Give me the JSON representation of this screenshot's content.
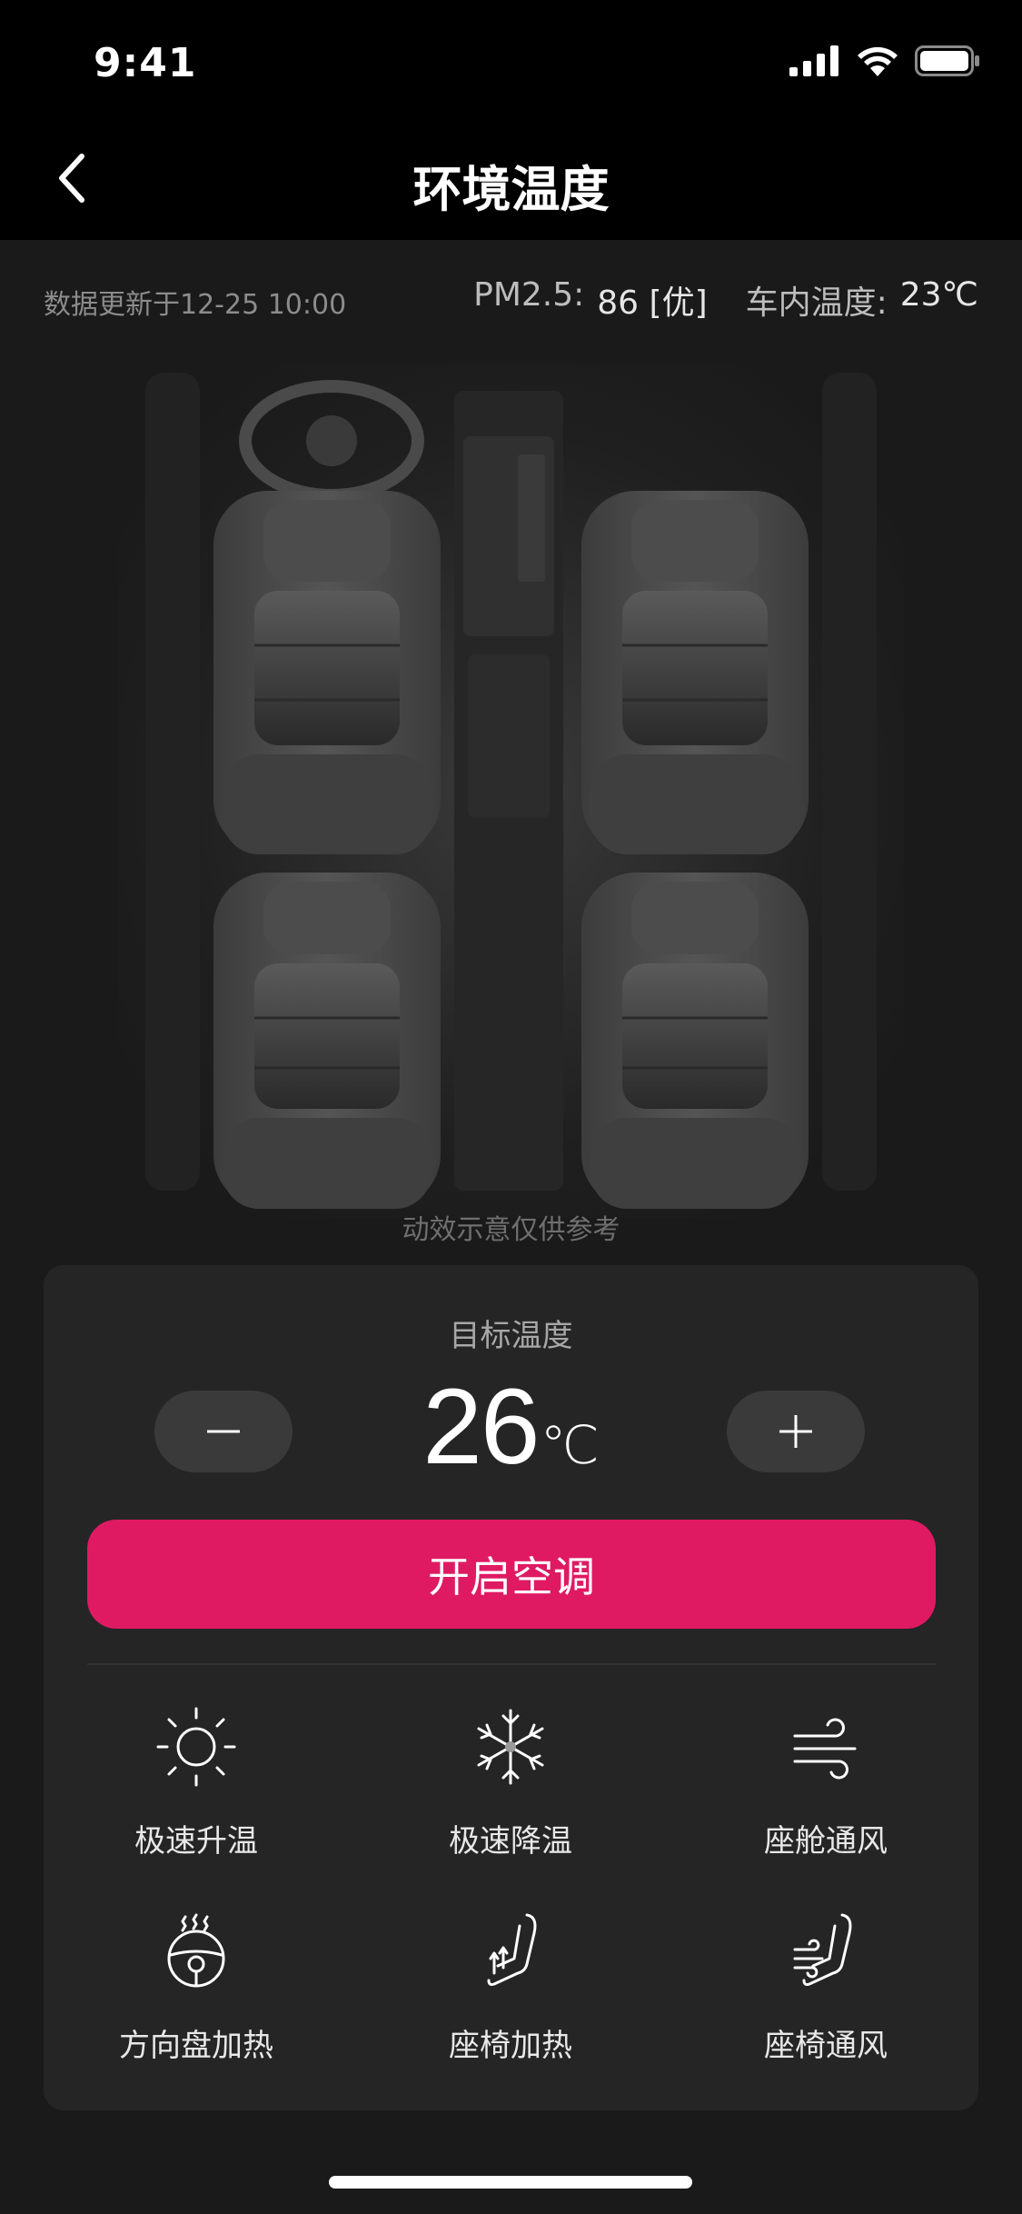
{
  "status": {
    "time": "9:41"
  },
  "nav": {
    "title": "环境温度"
  },
  "info": {
    "updated": "数据更新于12-25 10:00",
    "pm_label": "PM2.5:",
    "pm_value": "86 [优]",
    "cabin_label": "车内温度:",
    "cabin_value": "23℃"
  },
  "caption": "动效示意仅供参考",
  "control": {
    "target_label": "目标温度",
    "temperature": "26",
    "unit": "℃",
    "ac_button": "开启空调"
  },
  "features": [
    {
      "label": "极速升温",
      "icon": "sun-icon"
    },
    {
      "label": "极速降温",
      "icon": "snowflake-icon"
    },
    {
      "label": "座舱通风",
      "icon": "wind-icon"
    },
    {
      "label": "方向盘加热",
      "icon": "steering-heat-icon"
    },
    {
      "label": "座椅加热",
      "icon": "seat-heat-icon"
    },
    {
      "label": "座椅通风",
      "icon": "seat-vent-icon"
    }
  ],
  "colors": {
    "accent": "#df1a63",
    "background": "#1a1a1a",
    "panel": "#252525"
  }
}
